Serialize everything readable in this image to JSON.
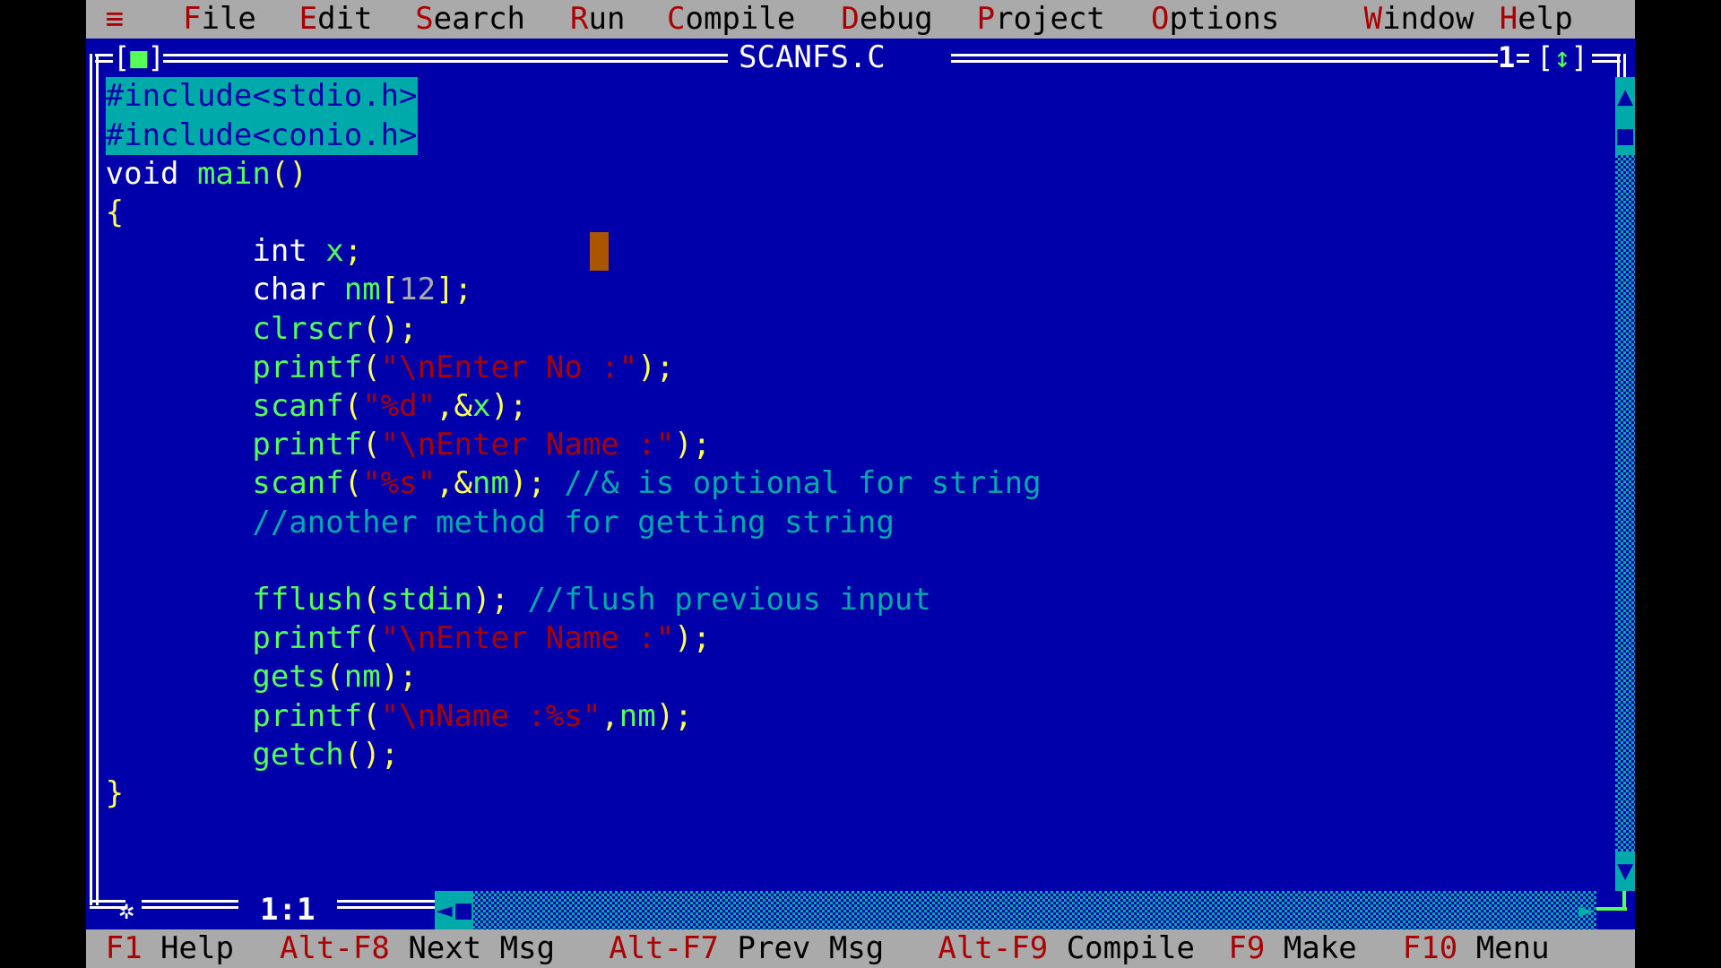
{
  "menubar": {
    "system_icon": "≡",
    "items": [
      {
        "hot": "F",
        "rest": "ile"
      },
      {
        "hot": "E",
        "rest": "dit"
      },
      {
        "hot": "S",
        "rest": "earch"
      },
      {
        "hot": "R",
        "rest": "un"
      },
      {
        "hot": "C",
        "rest": "ompile"
      },
      {
        "hot": "D",
        "rest": "ebug"
      },
      {
        "hot": "P",
        "rest": "roject"
      },
      {
        "hot": "O",
        "rest": "ptions"
      },
      {
        "hot": "W",
        "rest": "indow"
      },
      {
        "hot": "H",
        "rest": "elp"
      }
    ]
  },
  "window": {
    "close_box": "[■]",
    "title": "SCANFS.C",
    "number": "1",
    "zoom_box": "[↕]",
    "position": "1:1",
    "colors": {
      "background": "#0000AA",
      "selection": "#00AAAA",
      "cursor": "#AA5500"
    }
  },
  "code": [
    {
      "sel": true,
      "tokens": [
        {
          "t": "#include<stdio.h>",
          "c": "blue"
        }
      ]
    },
    {
      "sel": true,
      "tokens": [
        {
          "t": "#include<conio.h>",
          "c": "blue"
        }
      ]
    },
    {
      "tokens": [
        {
          "t": "void ",
          "c": "white"
        },
        {
          "t": "main",
          "c": "green"
        },
        {
          "t": "()",
          "c": "yellow"
        }
      ]
    },
    {
      "tokens": [
        {
          "t": "{",
          "c": "yellow"
        }
      ]
    },
    {
      "tokens": [
        {
          "t": "        int ",
          "c": "white"
        },
        {
          "t": "x",
          "c": "green"
        },
        {
          "t": ";",
          "c": "yellow"
        }
      ]
    },
    {
      "tokens": [
        {
          "t": "        char ",
          "c": "white"
        },
        {
          "t": "nm",
          "c": "green"
        },
        {
          "t": "[",
          "c": "yellow"
        },
        {
          "t": "12",
          "c": "gray"
        },
        {
          "t": "];",
          "c": "yellow"
        }
      ]
    },
    {
      "tokens": [
        {
          "t": "        clrscr",
          "c": "green"
        },
        {
          "t": "();",
          "c": "yellow"
        }
      ]
    },
    {
      "tokens": [
        {
          "t": "        printf",
          "c": "green"
        },
        {
          "t": "(",
          "c": "yellow"
        },
        {
          "t": "\"\\nEnter No :\"",
          "c": "red"
        },
        {
          "t": ");",
          "c": "yellow"
        }
      ]
    },
    {
      "tokens": [
        {
          "t": "        scanf",
          "c": "green"
        },
        {
          "t": "(",
          "c": "yellow"
        },
        {
          "t": "\"%d\"",
          "c": "red"
        },
        {
          "t": ",&",
          "c": "yellow"
        },
        {
          "t": "x",
          "c": "green"
        },
        {
          "t": ");",
          "c": "yellow"
        }
      ]
    },
    {
      "tokens": [
        {
          "t": "        printf",
          "c": "green"
        },
        {
          "t": "(",
          "c": "yellow"
        },
        {
          "t": "\"\\nEnter Name :\"",
          "c": "red"
        },
        {
          "t": ");",
          "c": "yellow"
        }
      ]
    },
    {
      "tokens": [
        {
          "t": "        scanf",
          "c": "green"
        },
        {
          "t": "(",
          "c": "yellow"
        },
        {
          "t": "\"%s\"",
          "c": "red"
        },
        {
          "t": ",&",
          "c": "yellow"
        },
        {
          "t": "nm",
          "c": "green"
        },
        {
          "t": "); ",
          "c": "yellow"
        },
        {
          "t": "//& is optional for string",
          "c": "cyan"
        }
      ]
    },
    {
      "tokens": [
        {
          "t": "        //another method for getting string",
          "c": "cyan"
        }
      ]
    },
    {
      "tokens": []
    },
    {
      "tokens": [
        {
          "t": "        fflush",
          "c": "green"
        },
        {
          "t": "(",
          "c": "yellow"
        },
        {
          "t": "stdin",
          "c": "green"
        },
        {
          "t": "); ",
          "c": "yellow"
        },
        {
          "t": "//flush previous input",
          "c": "cyan"
        }
      ]
    },
    {
      "tokens": [
        {
          "t": "        printf",
          "c": "green"
        },
        {
          "t": "(",
          "c": "yellow"
        },
        {
          "t": "\"\\nEnter Name :\"",
          "c": "red"
        },
        {
          "t": ");",
          "c": "yellow"
        }
      ]
    },
    {
      "tokens": [
        {
          "t": "        gets",
          "c": "green"
        },
        {
          "t": "(",
          "c": "yellow"
        },
        {
          "t": "nm",
          "c": "green"
        },
        {
          "t": ");",
          "c": "yellow"
        }
      ]
    },
    {
      "tokens": [
        {
          "t": "        printf",
          "c": "green"
        },
        {
          "t": "(",
          "c": "yellow"
        },
        {
          "t": "\"\\nName :%s\"",
          "c": "red"
        },
        {
          "t": ",",
          "c": "yellow"
        },
        {
          "t": "nm",
          "c": "green"
        },
        {
          "t": ");",
          "c": "yellow"
        }
      ]
    },
    {
      "tokens": [
        {
          "t": "        getch",
          "c": "green"
        },
        {
          "t": "();",
          "c": "yellow"
        }
      ]
    },
    {
      "tokens": [
        {
          "t": "}",
          "c": "yellow"
        }
      ]
    }
  ],
  "scrollbars": {
    "up_arrow": "▲",
    "down_arrow": "▼",
    "left_arrow": "◄",
    "right_arrow": "►",
    "thumb": "■"
  },
  "statusbar": {
    "items": [
      {
        "key": "F1",
        "label": "Help"
      },
      {
        "key": "Alt-F8",
        "label": "Next Msg"
      },
      {
        "key": "Alt-F7",
        "label": "Prev Msg"
      },
      {
        "key": "Alt-F9",
        "label": "Compile"
      },
      {
        "key": "F9",
        "label": "Make"
      },
      {
        "key": "F10",
        "label": "Menu"
      }
    ]
  }
}
